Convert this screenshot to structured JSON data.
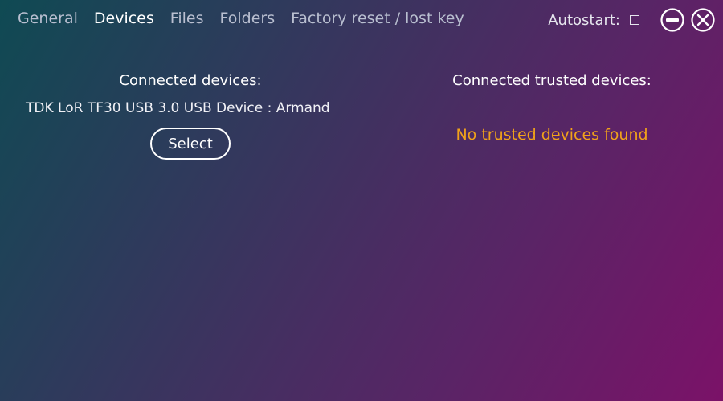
{
  "tabs": [
    {
      "label": "General"
    },
    {
      "label": "Devices"
    },
    {
      "label": "Files"
    },
    {
      "label": "Folders"
    },
    {
      "label": "Factory reset / lost key"
    }
  ],
  "active_tab": "Devices",
  "autostart": {
    "label": "Autostart:",
    "checked": false
  },
  "window_controls": {
    "minimize_icon": "minus-circle-icon",
    "close_icon": "x-circle-icon"
  },
  "connected": {
    "title": "Connected devices:",
    "devices": [
      "TDK LoR TF30 USB 3.0 USB Device : Armand"
    ],
    "select_label": "Select"
  },
  "trusted": {
    "title": "Connected trusted devices:",
    "empty_message": "No trusted devices found",
    "empty_color": "#f1a21a"
  },
  "colors": {
    "background_start": "#0f4a53",
    "background_end": "#7b1268",
    "inactive_tab": "#b9bfd0",
    "active_tab": "#ffffff"
  }
}
